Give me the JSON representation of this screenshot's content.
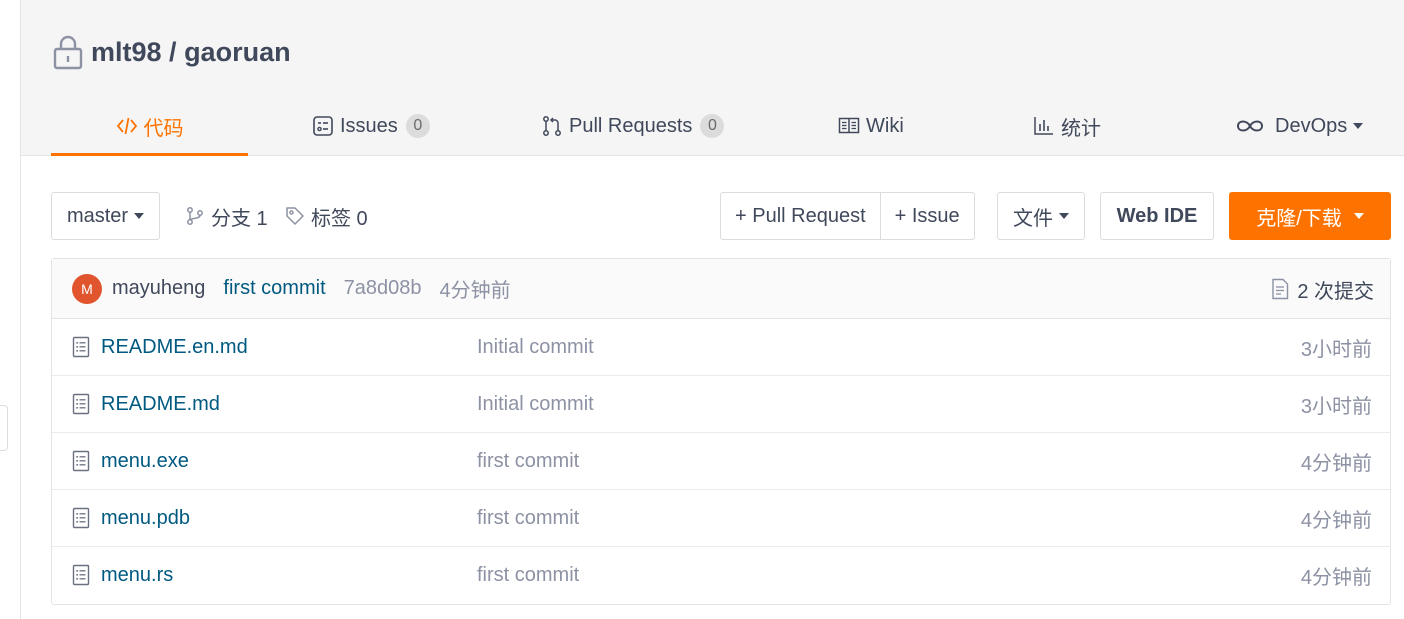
{
  "repo": {
    "owner": "mlt98",
    "separator": " / ",
    "name": "gaoruan"
  },
  "tabs": [
    {
      "label": "代码",
      "icon": "code-icon",
      "active": true
    },
    {
      "label": "Issues",
      "badge": "0",
      "icon": "issues-icon"
    },
    {
      "label": "Pull Requests",
      "badge": "0",
      "icon": "pull-request-icon"
    },
    {
      "label": "Wiki",
      "icon": "wiki-icon"
    },
    {
      "label": "统计",
      "icon": "chart-icon"
    },
    {
      "label": "DevOps",
      "icon": "infinity-icon",
      "has_dropdown": true
    }
  ],
  "toolbar": {
    "branch_select": "master",
    "branches_label": "分支 1",
    "tags_label": "标签 0",
    "new_pr": "+ Pull Request",
    "new_issue": "+ Issue",
    "file_menu": "文件",
    "web_ide": "Web IDE",
    "clone_download": "克隆/下载"
  },
  "last_commit": {
    "avatar_letter": "M",
    "author": "mayuheng",
    "message": "first commit",
    "hash": "7a8d08b",
    "time": "4分钟前",
    "count_label": "2 次提交"
  },
  "files": [
    {
      "name": "README.en.md",
      "commit": "Initial commit",
      "time": "3小时前"
    },
    {
      "name": "README.md",
      "commit": "Initial commit",
      "time": "3小时前"
    },
    {
      "name": "menu.exe",
      "commit": "first commit",
      "time": "4分钟前"
    },
    {
      "name": "menu.pdb",
      "commit": "first commit",
      "time": "4分钟前"
    },
    {
      "name": "menu.rs",
      "commit": "first commit",
      "time": "4分钟前"
    }
  ],
  "colors": {
    "accent": "#fe7300",
    "link": "#005980",
    "muted": "#8c92a4",
    "header_bg": "#f5f5f5",
    "avatar_bg": "#e0552e"
  }
}
